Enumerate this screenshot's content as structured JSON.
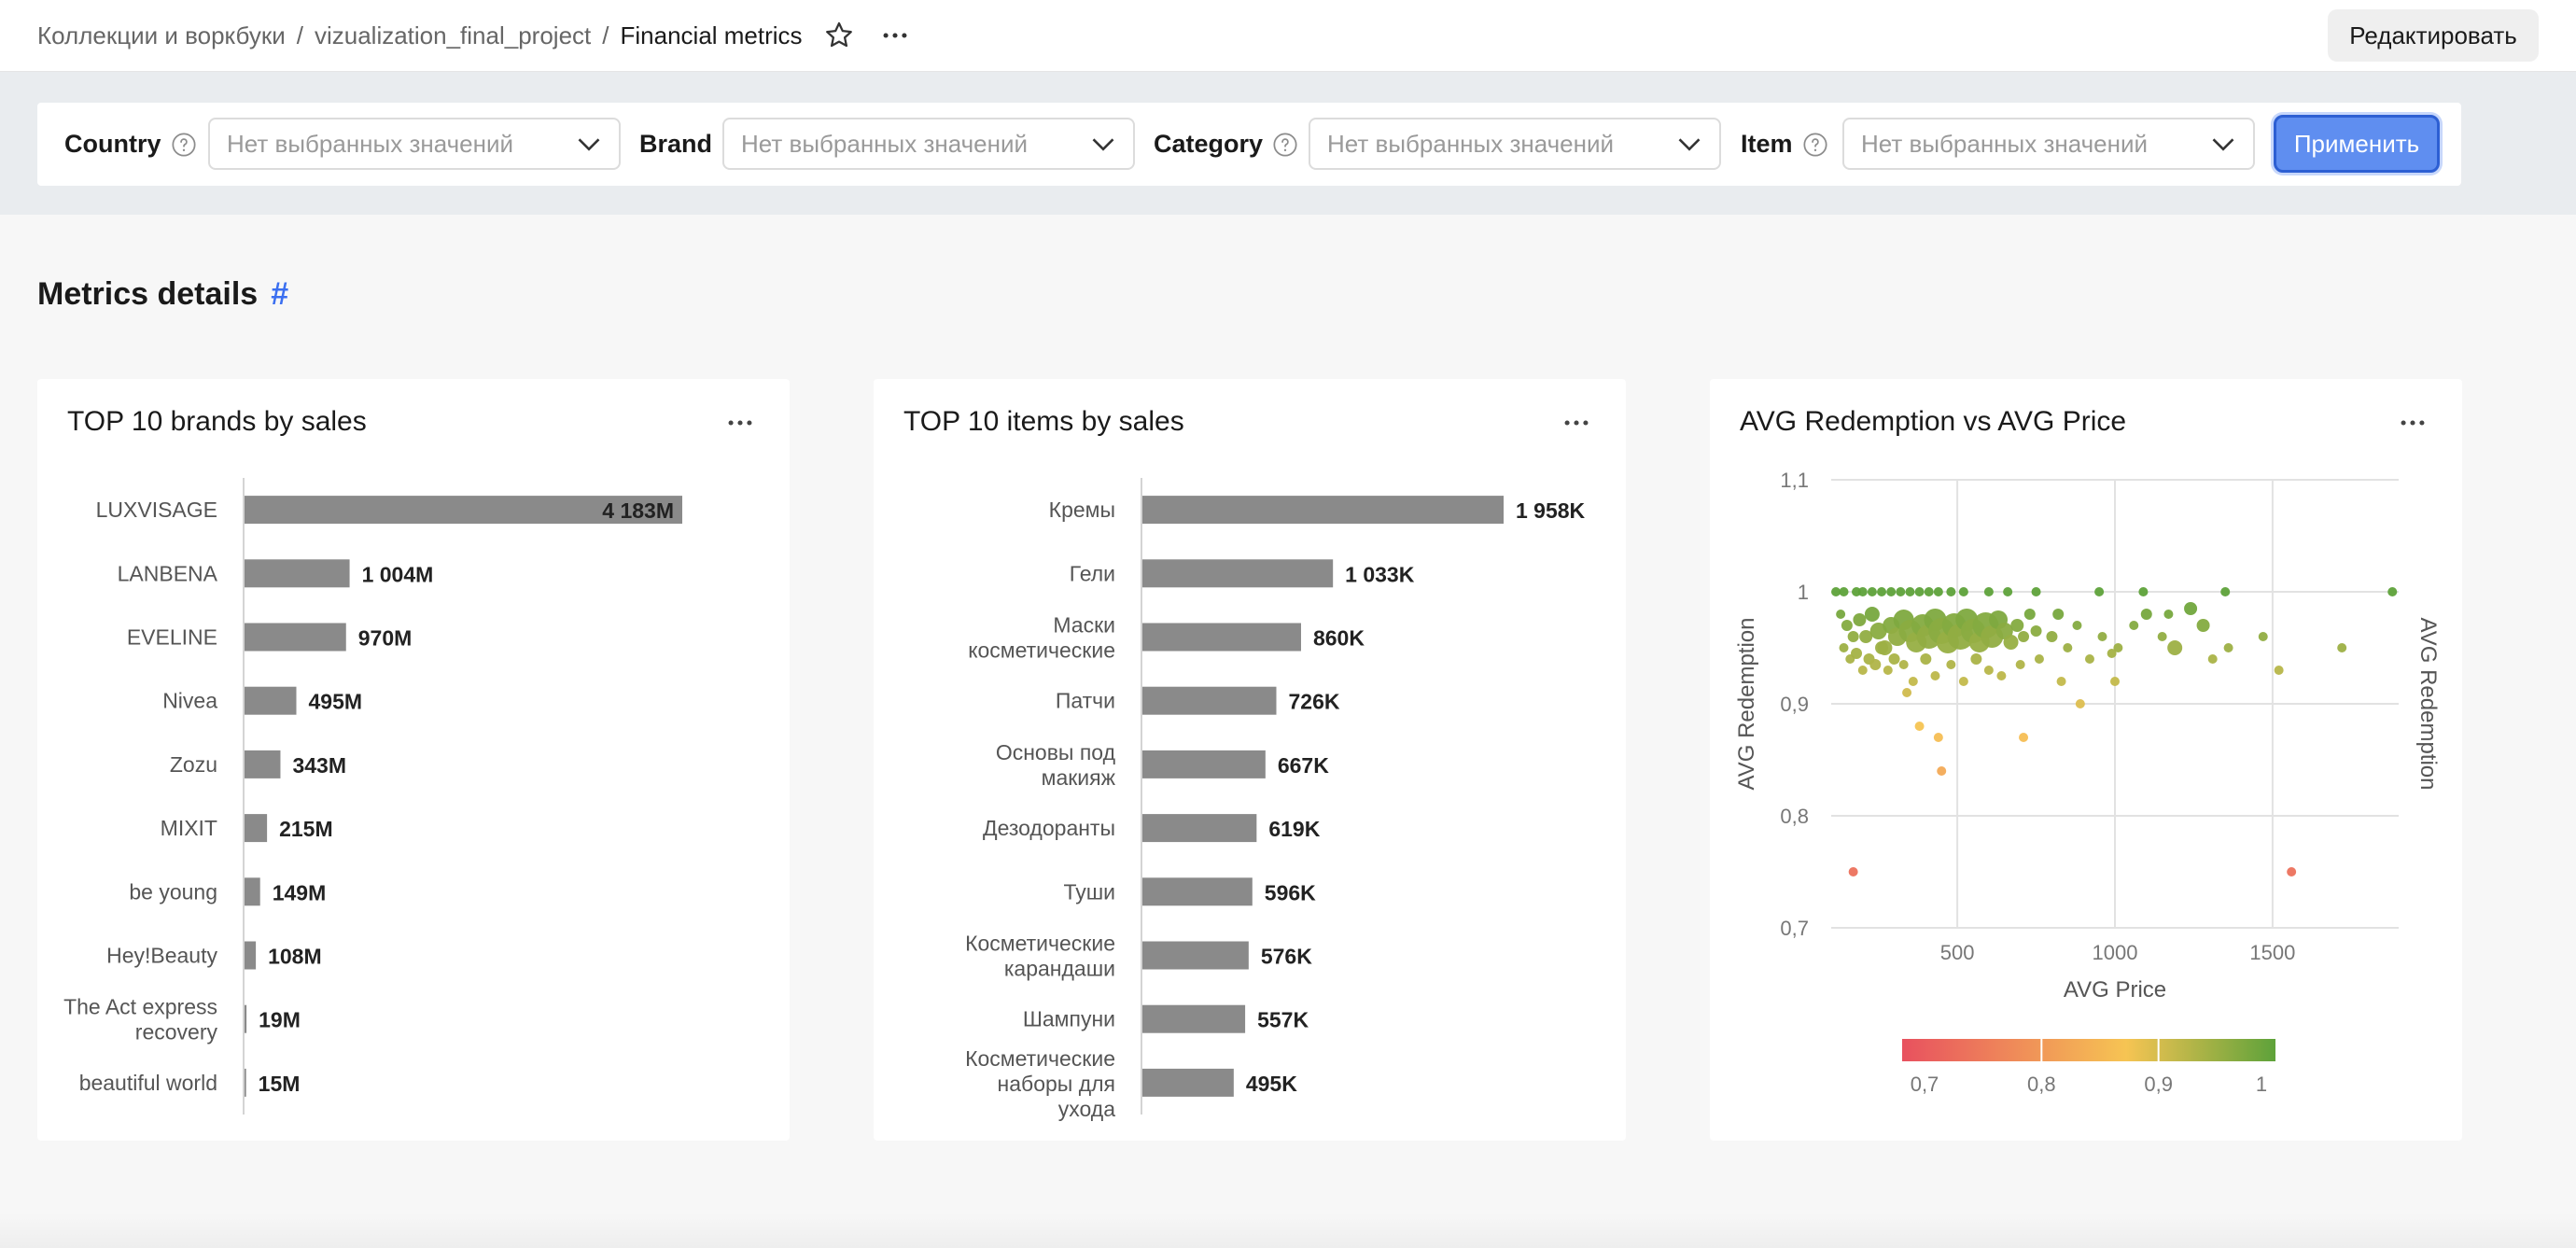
{
  "breadcrumb": {
    "root": "Коллекции и воркбуки",
    "project": "vizualization_final_project",
    "current": "Financial metrics",
    "separator": "/"
  },
  "header": {
    "edit_label": "Редактировать"
  },
  "filters": {
    "placeholder": "Нет выбранных значений",
    "country_label": "Country",
    "brand_label": "Brand",
    "category_label": "Category",
    "item_label": "Item",
    "apply_label": "Применить"
  },
  "section": {
    "title": "Metrics details",
    "anchor": "#"
  },
  "colors": {
    "bar": "#8a8a8a",
    "accent": "#3b6ff0",
    "apply": "#5f8ef0"
  },
  "chart_data": [
    {
      "type": "bar",
      "orientation": "horizontal",
      "title": "TOP 10 brands by sales",
      "categories": [
        "LUXVISAGE",
        "LANBENA",
        "EVELINE",
        "Nivea",
        "Zozu",
        "MIXIT",
        "be young",
        "Hey!Beauty",
        "The Act express recovery",
        "beautiful world"
      ],
      "values": [
        4183,
        1004,
        970,
        495,
        343,
        215,
        149,
        108,
        19,
        15
      ],
      "value_labels": [
        "4 183M",
        "1 004M",
        "970M",
        "495M",
        "343M",
        "215M",
        "149M",
        "108M",
        "19M",
        "15M"
      ],
      "unit": "M"
    },
    {
      "type": "bar",
      "orientation": "horizontal",
      "title": "TOP 10 items by sales",
      "categories": [
        "Кремы",
        "Гели",
        "Маски косметические",
        "Патчи",
        "Основы под макияж",
        "Дезодоранты",
        "Туши",
        "Косметические карандаши",
        "Шампуни",
        "Косметические наборы для ухода"
      ],
      "values": [
        1958,
        1033,
        860,
        726,
        667,
        619,
        596,
        576,
        557,
        495
      ],
      "value_labels": [
        "1 958K",
        "1 033K",
        "860K",
        "726K",
        "667K",
        "619K",
        "596K",
        "576K",
        "557K",
        "495K"
      ],
      "unit": "K"
    },
    {
      "type": "scatter",
      "title": "AVG Redemption vs AVG Price",
      "xlabel": "AVG Price",
      "ylabel": "AVG Redemption",
      "ylabel_right": "AVG Redemption",
      "xlim": [
        100,
        1900
      ],
      "ylim": [
        0.7,
        1.1
      ],
      "xticks": [
        500,
        1000,
        1500
      ],
      "xtick_labels": [
        "500",
        "1000",
        "1500"
      ],
      "yticks": [
        0.7,
        0.8,
        0.9,
        1.0,
        1.1
      ],
      "ytick_labels": [
        "0,7",
        "0,8",
        "0,9",
        "1",
        "1,1"
      ],
      "grid": true,
      "color_scale": {
        "min": 0.7,
        "max": 1.0,
        "stops": [
          "#e8515f",
          "#f6c453",
          "#5ea23a"
        ],
        "tick_labels": [
          "0,7",
          "0,8",
          "0,9",
          "1"
        ]
      },
      "points": [
        [
          115,
          1.0,
          5
        ],
        [
          140,
          1.0,
          5
        ],
        [
          180,
          1.0,
          5
        ],
        [
          200,
          1.0,
          5
        ],
        [
          230,
          1.0,
          5
        ],
        [
          260,
          1.0,
          5
        ],
        [
          290,
          1.0,
          5
        ],
        [
          320,
          1.0,
          5
        ],
        [
          350,
          1.0,
          5
        ],
        [
          380,
          1.0,
          5
        ],
        [
          410,
          1.0,
          5
        ],
        [
          440,
          1.0,
          5
        ],
        [
          480,
          1.0,
          5
        ],
        [
          520,
          1.0,
          5
        ],
        [
          600,
          1.0,
          5
        ],
        [
          660,
          1.0,
          5
        ],
        [
          750,
          1.0,
          5
        ],
        [
          950,
          1.0,
          5
        ],
        [
          1090,
          1.0,
          5
        ],
        [
          1350,
          1.0,
          5
        ],
        [
          1880,
          1.0,
          5
        ],
        [
          130,
          0.98,
          5
        ],
        [
          150,
          0.97,
          6
        ],
        [
          170,
          0.96,
          6
        ],
        [
          190,
          0.975,
          7
        ],
        [
          210,
          0.96,
          7
        ],
        [
          230,
          0.98,
          8
        ],
        [
          250,
          0.965,
          9
        ],
        [
          270,
          0.95,
          8
        ],
        [
          290,
          0.97,
          9
        ],
        [
          310,
          0.96,
          10
        ],
        [
          330,
          0.975,
          11
        ],
        [
          350,
          0.965,
          12
        ],
        [
          370,
          0.955,
          11
        ],
        [
          390,
          0.97,
          12
        ],
        [
          410,
          0.96,
          13
        ],
        [
          430,
          0.975,
          12
        ],
        [
          450,
          0.965,
          14
        ],
        [
          470,
          0.955,
          12
        ],
        [
          490,
          0.97,
          13
        ],
        [
          510,
          0.96,
          14
        ],
        [
          530,
          0.975,
          12
        ],
        [
          550,
          0.965,
          13
        ],
        [
          570,
          0.955,
          11
        ],
        [
          590,
          0.97,
          14
        ],
        [
          610,
          0.96,
          12
        ],
        [
          630,
          0.975,
          10
        ],
        [
          650,
          0.965,
          9
        ],
        [
          670,
          0.955,
          8
        ],
        [
          690,
          0.97,
          7
        ],
        [
          710,
          0.96,
          6
        ],
        [
          730,
          0.98,
          6
        ],
        [
          750,
          0.965,
          6
        ],
        [
          140,
          0.95,
          5
        ],
        [
          160,
          0.94,
          5
        ],
        [
          180,
          0.945,
          6
        ],
        [
          200,
          0.93,
          5
        ],
        [
          220,
          0.94,
          6
        ],
        [
          240,
          0.935,
          6
        ],
        [
          260,
          0.95,
          7
        ],
        [
          280,
          0.93,
          5
        ],
        [
          300,
          0.94,
          6
        ],
        [
          330,
          0.935,
          5
        ],
        [
          360,
          0.92,
          5
        ],
        [
          400,
          0.94,
          6
        ],
        [
          430,
          0.925,
          5
        ],
        [
          480,
          0.935,
          5
        ],
        [
          520,
          0.92,
          5
        ],
        [
          560,
          0.94,
          6
        ],
        [
          600,
          0.93,
          5
        ],
        [
          640,
          0.925,
          5
        ],
        [
          700,
          0.935,
          5
        ],
        [
          760,
          0.94,
          5
        ],
        [
          800,
          0.96,
          6
        ],
        [
          820,
          0.98,
          6
        ],
        [
          850,
          0.95,
          5
        ],
        [
          880,
          0.97,
          5
        ],
        [
          920,
          0.94,
          5
        ],
        [
          960,
          0.96,
          5
        ],
        [
          1010,
          0.95,
          5
        ],
        [
          1060,
          0.97,
          5
        ],
        [
          1100,
          0.98,
          6
        ],
        [
          1150,
          0.96,
          5
        ],
        [
          1190,
          0.95,
          8
        ],
        [
          1240,
          0.985,
          7
        ],
        [
          1280,
          0.97,
          7
        ],
        [
          1310,
          0.94,
          5
        ],
        [
          1360,
          0.95,
          5
        ],
        [
          1470,
          0.96,
          5
        ],
        [
          1520,
          0.93,
          5
        ],
        [
          1720,
          0.95,
          5
        ],
        [
          890,
          0.9,
          5
        ],
        [
          830,
          0.92,
          5
        ],
        [
          1000,
          0.92,
          5
        ],
        [
          990,
          0.945,
          5
        ],
        [
          1170,
          0.98,
          5
        ],
        [
          340,
          0.91,
          5
        ],
        [
          380,
          0.88,
          5
        ],
        [
          440,
          0.87,
          5
        ],
        [
          710,
          0.87,
          5
        ],
        [
          450,
          0.84,
          5
        ],
        [
          170,
          0.75,
          5
        ],
        [
          1560,
          0.75,
          5
        ]
      ]
    }
  ]
}
